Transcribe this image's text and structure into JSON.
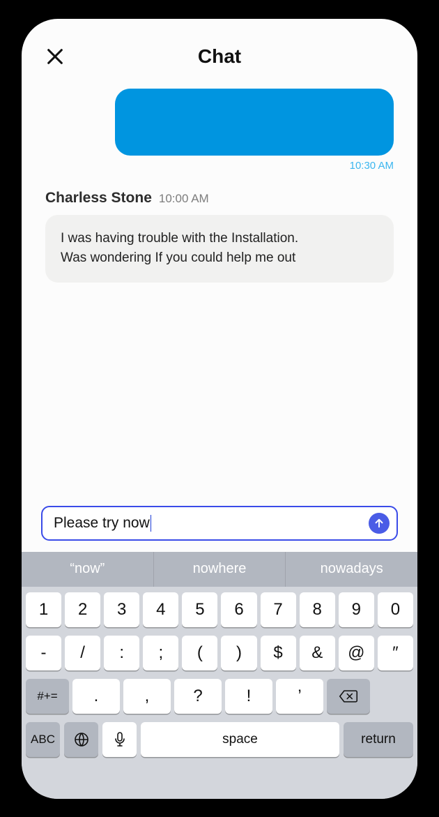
{
  "header": {
    "title": "Chat"
  },
  "out": {
    "text": "",
    "time": "10:30 AM"
  },
  "in": {
    "name": "Charless Stone",
    "time": "10:00 AM",
    "l1": "I was having trouble with the Installation.",
    "l2": "Was wondering If you could help me out"
  },
  "composer": {
    "value": "Please try now"
  },
  "sugg": {
    "s1": "“now”",
    "s2": "nowhere",
    "s3": "nowadays"
  },
  "kbd": {
    "r1": [
      "1",
      "2",
      "3",
      "4",
      "5",
      "6",
      "7",
      "8",
      "9",
      "0"
    ],
    "r2": [
      "-",
      "/",
      ":",
      ";",
      "(",
      ")",
      "$",
      "&",
      "@",
      "″"
    ],
    "r3_shift": "#+=",
    "r3": [
      ".",
      ",",
      "?",
      "!",
      "’"
    ],
    "abc": "ABC",
    "space": "space",
    "ret": "return"
  }
}
